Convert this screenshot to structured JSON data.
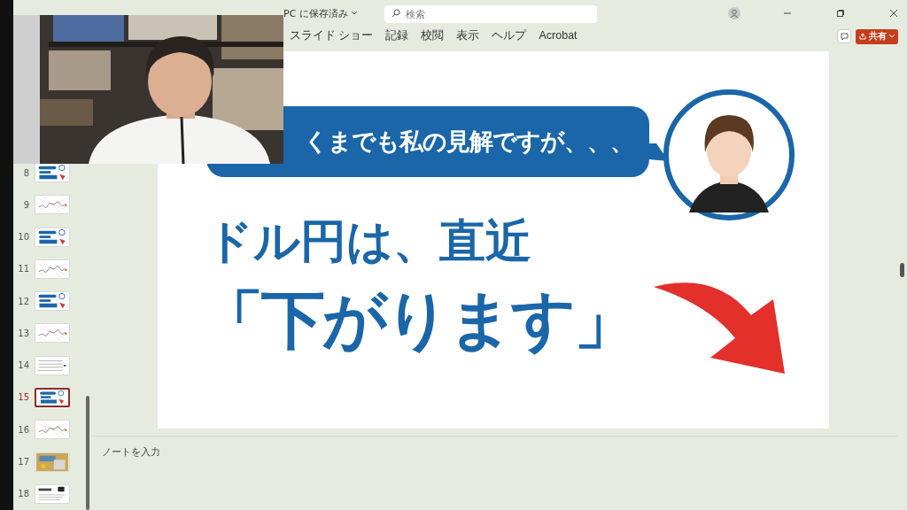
{
  "title_bar": {
    "document_status": "PC に保存済み",
    "search": {
      "placeholder": "検索"
    }
  },
  "ribbon": {
    "tabs": [
      {
        "label": "スライド ショー",
        "selected": false
      },
      {
        "label": "記録",
        "selected": false
      },
      {
        "label": "校閲",
        "selected": false
      },
      {
        "label": "表示",
        "selected": false
      },
      {
        "label": "ヘルプ",
        "selected": false
      },
      {
        "label": "Acrobat",
        "selected": false
      }
    ],
    "share_button": "共有"
  },
  "thumbnails": [
    {
      "number": "8",
      "kind": "bubble",
      "selected": false
    },
    {
      "number": "9",
      "kind": "chart",
      "selected": false
    },
    {
      "number": "10",
      "kind": "bubble",
      "selected": false
    },
    {
      "number": "11",
      "kind": "chart",
      "selected": false
    },
    {
      "number": "12",
      "kind": "bubble",
      "selected": false
    },
    {
      "number": "13",
      "kind": "chart",
      "selected": false
    },
    {
      "number": "14",
      "kind": "table",
      "selected": false
    },
    {
      "number": "15",
      "kind": "bubble",
      "selected": true
    },
    {
      "number": "16",
      "kind": "chart",
      "selected": false
    },
    {
      "number": "17",
      "selected": false
    },
    {
      "number": "18",
      "kind": "qa",
      "selected": false
    }
  ],
  "slide": {
    "bubble_text": "くまでも私の見解ですが、、、",
    "headline": "ドル円は、直近",
    "emphasis": "「下がります」"
  },
  "notes": {
    "placeholder": "ノートを入力"
  }
}
